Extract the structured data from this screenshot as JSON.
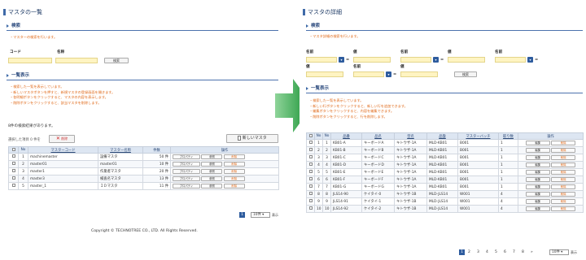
{
  "left": {
    "title": "マスタの一覧",
    "search_section": "検索",
    "search_note": "・マスターの検索を行います。",
    "code_label": "コード",
    "name_label": "名称",
    "search_button": "検索",
    "list_section": "一覧表示",
    "list_notes": [
      "・検索した一覧を表示しています。",
      "・新しいマスタボタンを押すと、新規マスタの登録画面を開きます。",
      "・各明細ボタンをクリックすると、マスタの内容を表示します。",
      "・削除ボタンをクリックすると、該当マスタを削除します。"
    ],
    "result_text": "8件の検索結果があります。",
    "selected_text": "選択した項目 0 件を",
    "delete_button": "削除",
    "new_button": "新しいマスタ",
    "headers": [
      "No",
      "マスターコード",
      "マスター名称",
      "件数",
      "操作"
    ],
    "rows": [
      {
        "no": "1",
        "code": "machinemaster",
        "name": "設備マスタ",
        "count": "50 件"
      },
      {
        "no": "2",
        "code": "master01",
        "name": "master01",
        "count": "10 件"
      },
      {
        "no": "3",
        "code": "master1",
        "name": "作業者マスタ",
        "count": "20 件"
      },
      {
        "no": "4",
        "code": "master3",
        "name": "検査名マスタ",
        "count": "13 件"
      },
      {
        "no": "5",
        "code": "master_1",
        "name": "ＩＤマスタ",
        "count": "11 件"
      }
    ],
    "row_buttons": [
      "プロパティ",
      "参照",
      "削除"
    ],
    "page_current": "1",
    "page_size": "10件",
    "page_size_suffix": "表示",
    "copyright": "Copyright © TECHNOTREE CO., LTD. All Rights Reserved."
  },
  "right": {
    "title": "マスタの詳細",
    "search_section": "検索",
    "search_note": "・マスタ詳細の検索を行います。",
    "field_labels": [
      "名前",
      "値",
      "名前",
      "値",
      "名前",
      "値",
      "名前",
      "値"
    ],
    "eq": "=",
    "search_button": "検索",
    "list_section": "一覧表示",
    "list_notes": [
      "・検索した一覧を表示しています。",
      "・新しい行ボタンをクリックすると、新しい行を追加できます。",
      "・編集ボタンをクリックすると、内容を編集できます。",
      "・削除ボタンをクリックすると、行を削除します。"
    ],
    "headers": [
      "No",
      "品番",
      "品名",
      "型名",
      "品盤",
      "マスターバッチ",
      "取り数",
      "操作"
    ],
    "rows": [
      {
        "no": "1",
        "sub": "1",
        "a": "KB01-A",
        "b": "キーボードA",
        "c": "キトウザ-1A",
        "d": "MLD-KB01",
        "e": "B001",
        "f": "1"
      },
      {
        "no": "2",
        "sub": "2",
        "a": "KB01-B",
        "b": "キーボードB",
        "c": "キトウザ-1A",
        "d": "MLD-KB01",
        "e": "B001",
        "f": "1"
      },
      {
        "no": "3",
        "sub": "3",
        "a": "KB01-C",
        "b": "キーボードC",
        "c": "キトウザ-1A",
        "d": "MLD-KB01",
        "e": "B001",
        "f": "1"
      },
      {
        "no": "4",
        "sub": "4",
        "a": "KB01-D",
        "b": "キーボードD",
        "c": "キトウザ-1A",
        "d": "MLD-KB01",
        "e": "B001",
        "f": "1"
      },
      {
        "no": "5",
        "sub": "5",
        "a": "KB01-E",
        "b": "キーボードE",
        "c": "キトウザ-1A",
        "d": "MLD-KB01",
        "e": "B001",
        "f": "1"
      },
      {
        "no": "6",
        "sub": "6",
        "a": "KB01-F",
        "b": "キーボードF",
        "c": "キトウザ-1A",
        "d": "MLD-KB01",
        "e": "B001",
        "f": "1"
      },
      {
        "no": "7",
        "sub": "7",
        "a": "KB01-G",
        "b": "キーボードG",
        "c": "キトウザ-1A",
        "d": "MLD-KB01",
        "e": "B001",
        "f": "1"
      },
      {
        "no": "8",
        "sub": "8",
        "a": "JLS14-90",
        "b": "ケイタイ-0",
        "c": "キトウザ-1B",
        "d": "MLD-JLS14",
        "e": "W001",
        "f": "4"
      },
      {
        "no": "9",
        "sub": "9",
        "a": "JLS14-91",
        "b": "ケイタイ-1",
        "c": "キトウザ-1B",
        "d": "MLD-JLS14",
        "e": "W001",
        "f": "4"
      },
      {
        "no": "10",
        "sub": "10",
        "a": "JLS14-92",
        "b": "ケイタイ-2",
        "c": "キトウザ-1B",
        "d": "MLD-JLS14",
        "e": "W001",
        "f": "4"
      }
    ],
    "row_buttons": [
      "編集",
      "削除"
    ],
    "pages": [
      "1",
      "2",
      "3",
      "4",
      "5",
      "6",
      "7",
      "8",
      "»"
    ],
    "page_size": "10件",
    "page_size_suffix": "表示"
  },
  "colors": {
    "accent": "#2e5c9e",
    "note": "#e06a1a",
    "arrow": "#1a9a3a",
    "input": "#fff4c2"
  }
}
